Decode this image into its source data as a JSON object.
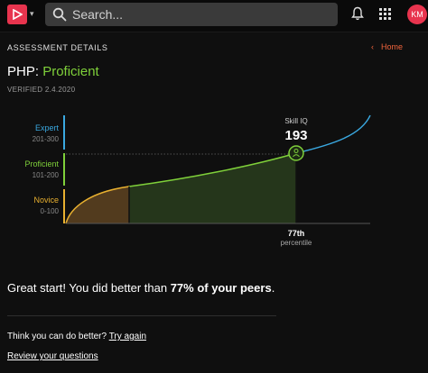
{
  "header": {
    "search_placeholder": "Search...",
    "avatar_initials": "KM",
    "brand_color": "#e8344e"
  },
  "assessment": {
    "section_label": "ASSESSMENT DETAILS",
    "home_link": "Home",
    "skill_name": "PHP:",
    "level": "Proficient",
    "verified": "VERIFIED 2.4.2020"
  },
  "chart_data": {
    "type": "area",
    "levels": [
      {
        "name": "Expert",
        "range": "201-300",
        "color": "#3aa8e0"
      },
      {
        "name": "Proficient",
        "range": "101-200",
        "color": "#7fd03a"
      },
      {
        "name": "Novice",
        "range": "0-100",
        "color": "#e8b030"
      }
    ],
    "score_label": "Skill IQ",
    "score": "193",
    "percentile_value": "77th",
    "percentile_label": "percentile",
    "percentile": 77
  },
  "result": {
    "prefix": "Great start! You did better than ",
    "highlight": "77% of your peers",
    "suffix": "."
  },
  "retry": {
    "prompt": "Think you can do better?",
    "link": "Try again"
  },
  "review_link": "Review your questions"
}
